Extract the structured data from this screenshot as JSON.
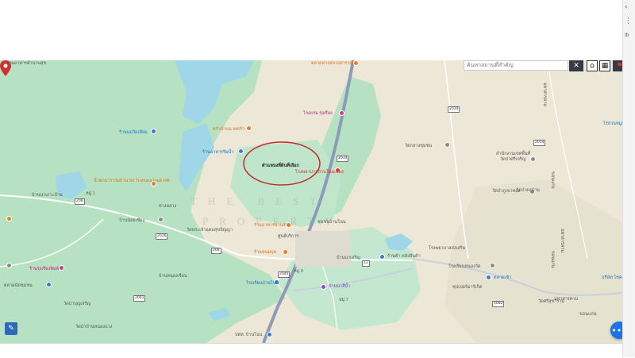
{
  "search": {
    "placeholder": "ค้นหาสถานที่สำคัญ"
  },
  "toolbar": {
    "close": "✕",
    "home": "⌂",
    "grid": "▦",
    "flag": "⚑"
  },
  "fab": {
    "label": "•••"
  },
  "chrome": {
    "back": "‹",
    "menu": "⋮",
    "tag": "Ib"
  },
  "watermark": {
    "line1": "THE BEST",
    "line2": "PROPERTY"
  },
  "highlight": {
    "label": "ตำแหน่งที่ดินที่เลือก",
    "color": "#c62828"
  },
  "colors": {
    "water": "#9fd6e8",
    "forest": "#a9dcb8",
    "land": "#ece7d6",
    "road_main": "#8d9ab8",
    "road_minor": "#ffffff"
  },
  "labels": {
    "l1": "ตลาดทางหลวงสาราญ",
    "l2": "โรงแรม รุ่งเรือง",
    "l3": "ร้านแม่วัดเอียม",
    "l4": "ครัวบ้านนายครัว",
    "l5": "วัดกลางชุมชน",
    "l6": "ร้านอาหารริมน้ำ",
    "l7": "โรงพยาบาลบ้านโนนเมือง",
    "l8": "น้ำตกธารารมบ้าน Sri Trumara Park Hill",
    "l9": "หมู่ 1",
    "l10": "บ้านนาเกาะบ้าน",
    "l11": "บ้านน้อยเชียง",
    "l12": "วัดพระเจ้าอุดมสุขปัญญา",
    "l13": "ร้านขนมบุษ",
    "l14": "ศูนย์บริการ",
    "l15": "บ้านหนองเรือน",
    "l16": "โรงเรียนบ้านโนน",
    "l17": "ร้านรุ่งเรืองพิมพ์",
    "l18": "ตลาดนัดชุมชน",
    "l19": "วัดป่าบุญเจริญ",
    "l20": "วัดป่าบ้านหนองแวง",
    "l21": "บ้านนาสีน้ำ",
    "l22": "ร้านค้า คลังสินค้า",
    "l23": "วัดป่าภูเขาทอง",
    "l24": "สำนักงานเขตพื้นที่",
    "l25": "โรงเรียนหนองวัด",
    "l26": "ตลาดเช้า",
    "l27": "ซุปเปอร์มาร์เก็ต",
    "l28": "บ้านนาเจริญ",
    "l29": "หมู่ 9",
    "l30": "หมู่ 7",
    "l31": "โรงพยาบาลส่งเสริม",
    "l32": "วัดศรีสุขาราม",
    "l33": "วัดป่าศรีเจริญ",
    "l34": "ชุมชนบ้านโนน",
    "l35": "ร้านอาหารบ้านสวน",
    "l36": "ทางหลวง",
    "l37": "ร้านอาหารตำนานสุข",
    "l38": "ปตท. บ้านโนน",
    "l39": "มหาสารคาม",
    "l40": "ขอนแก่น",
    "l41": "ไร่สวนหมูแดง",
    "l42": "วัดป่าดงบ้าน",
    "l43": "บริษัท โชคดี"
  },
  "shields": {
    "s1": "2034",
    "s2": "2034",
    "s3": "2034",
    "s4": "208",
    "s5": "2036",
    "s6": "208",
    "s7": "12",
    "s8": "4082",
    "s9": "2040",
    "s10": "2001"
  }
}
